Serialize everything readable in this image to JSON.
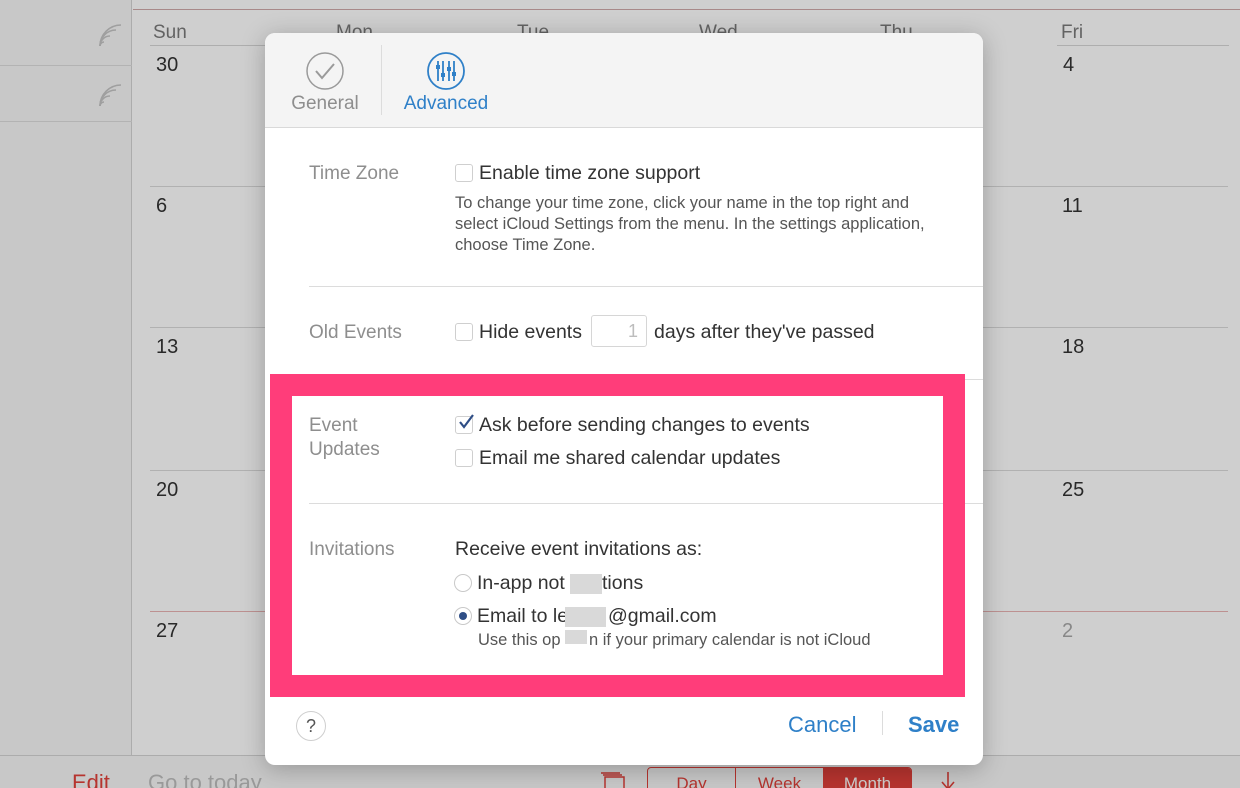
{
  "calendar": {
    "weekdays": [
      "Sun",
      "Mon",
      "Tue",
      "Wed",
      "Thu",
      "Fri"
    ],
    "day_numbers": {
      "week1": {
        "sun": "30",
        "fri": "4"
      },
      "week2": {
        "sun": "6",
        "fri": "11"
      },
      "week3": {
        "sun": "13",
        "fri": "18"
      },
      "week4": {
        "sun": "20",
        "fri": "25"
      },
      "week5": {
        "sun": "27",
        "fri": "2"
      }
    }
  },
  "bottom_bar": {
    "edit": "Edit",
    "go_to_today": "Go to today",
    "views": [
      "Day",
      "Week",
      "Month"
    ],
    "active_view": "Month"
  },
  "dialog": {
    "tabs": {
      "general": "General",
      "advanced": "Advanced",
      "active": "Advanced"
    },
    "time_zone": {
      "label": "Time Zone",
      "checkbox_label": "Enable time zone support",
      "checked": false,
      "help_lines": [
        "To change your time zone, click your name in the top right and",
        "select iCloud Settings from the menu. In the settings application,",
        "choose Time Zone."
      ]
    },
    "old_events": {
      "label": "Old Events",
      "checkbox_label": "Hide events",
      "checked": false,
      "days_value": "1",
      "suffix": "days after they've passed"
    },
    "event_updates": {
      "label_line1": "Event",
      "label_line2": "Updates",
      "option1": "Ask before sending changes to events",
      "option1_checked": true,
      "option2": "Email me shared calendar updates",
      "option2_checked": false
    },
    "invitations": {
      "label": "Invitations",
      "heading": "Receive event invitations as:",
      "option1_part1": "In-app not",
      "option1_part2": "tions",
      "option2_part1": "Email to le",
      "option2_part2": "@gmail.com",
      "selected": "email",
      "note_part1": "Use this op",
      "note_part2": "n if your primary calendar is not iCloud"
    },
    "help": "?",
    "cancel": "Cancel",
    "save": "Save"
  },
  "colors": {
    "accent_blue": "#2f80c8",
    "calendar_red": "#e0413a",
    "highlight_pink": "#ff3d7a"
  },
  "icons": [
    "wireless-feed-icon",
    "checkmark-circle-icon",
    "sliders-icon",
    "calendar-stack-icon",
    "download-arrow-icon"
  ]
}
